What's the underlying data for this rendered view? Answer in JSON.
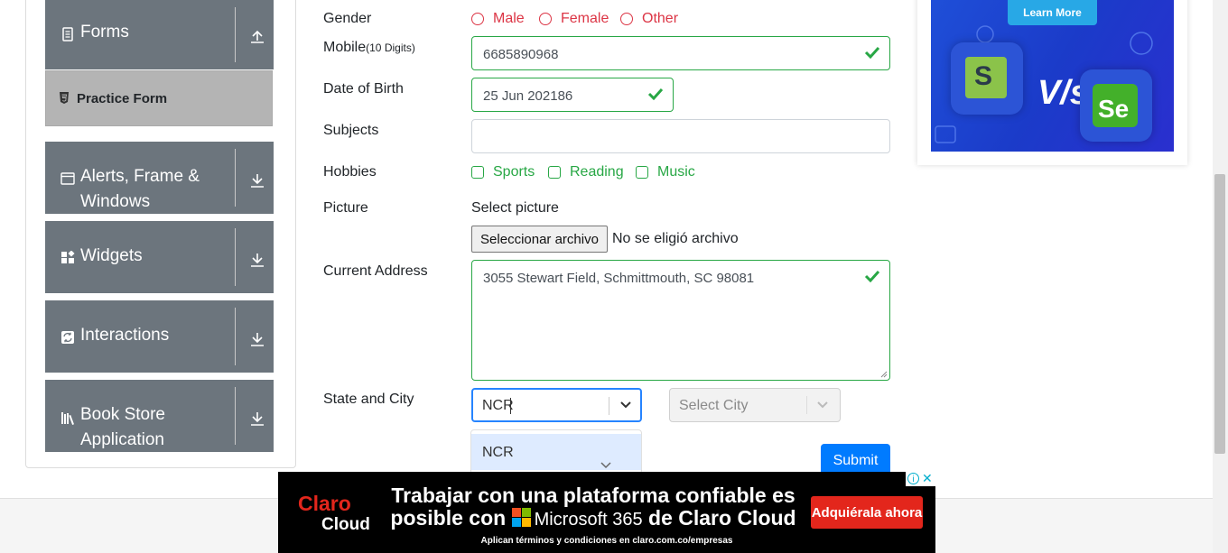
{
  "sidebar": {
    "groups": [
      {
        "label": "Forms",
        "icon": "form-icon",
        "arrow": "arrow-up-icon"
      },
      {
        "label": "Alerts, Frame &",
        "label2": "Windows",
        "icon": "window-icon",
        "arrow": "arrow-down-icon"
      },
      {
        "label": "Widgets",
        "icon": "widgets-icon",
        "arrow": "arrow-down-icon"
      },
      {
        "label": "Interactions",
        "icon": "interactions-icon",
        "arrow": "arrow-down-icon"
      },
      {
        "label": "Book Store",
        "label2": "Application",
        "icon": "books-icon",
        "arrow": "arrow-down-icon"
      }
    ],
    "active_item": {
      "label": "Practice Form",
      "icon": "html5-icon"
    }
  },
  "form": {
    "gender": {
      "label": "Gender",
      "options": [
        "Male",
        "Female",
        "Other"
      ]
    },
    "mobile": {
      "label": "Mobile",
      "hint": "(10 Digits)",
      "value": "6685890968"
    },
    "dob": {
      "label": "Date of Birth",
      "value": "25 Jun 202186"
    },
    "subjects": {
      "label": "Subjects",
      "value": ""
    },
    "hobbies": {
      "label": "Hobbies",
      "options": [
        "Sports",
        "Reading",
        "Music"
      ]
    },
    "picture": {
      "label": "Picture",
      "select_text": "Select picture",
      "button": "Seleccionar archivo",
      "status": "No se eligió archivo"
    },
    "address": {
      "label": "Current Address",
      "value": "3055 Stewart Field, Schmittmouth, SC 98081"
    },
    "state_city": {
      "label": "State and City",
      "state_value": "NCR",
      "city_placeholder": "Select City",
      "menu_options": [
        "NCR"
      ]
    },
    "submit_label": "Submit"
  },
  "ads": {
    "top": {
      "button": "Learn More",
      "logo_left": "S",
      "vs": "V/s",
      "logo_right": "Se"
    },
    "bottom": {
      "brand_top": "Claro",
      "brand_bottom": "Cloud",
      "headline_1": "Trabajar con una plataforma confiable es",
      "headline_2a": "posible con",
      "headline_2b": "Microsoft 365",
      "headline_2c": "de Claro Cloud",
      "cta": "Adquiérala ahora",
      "footnote": "Aplican términos y condiciones en claro.com.co/empresas"
    }
  },
  "colors": {
    "sidebar_group": "#6c757d",
    "active_item": "#b4b4b4",
    "valid": "#28a745",
    "invalid": "#dc3545",
    "primary": "#007bff",
    "claro_red": "#e3261c"
  }
}
